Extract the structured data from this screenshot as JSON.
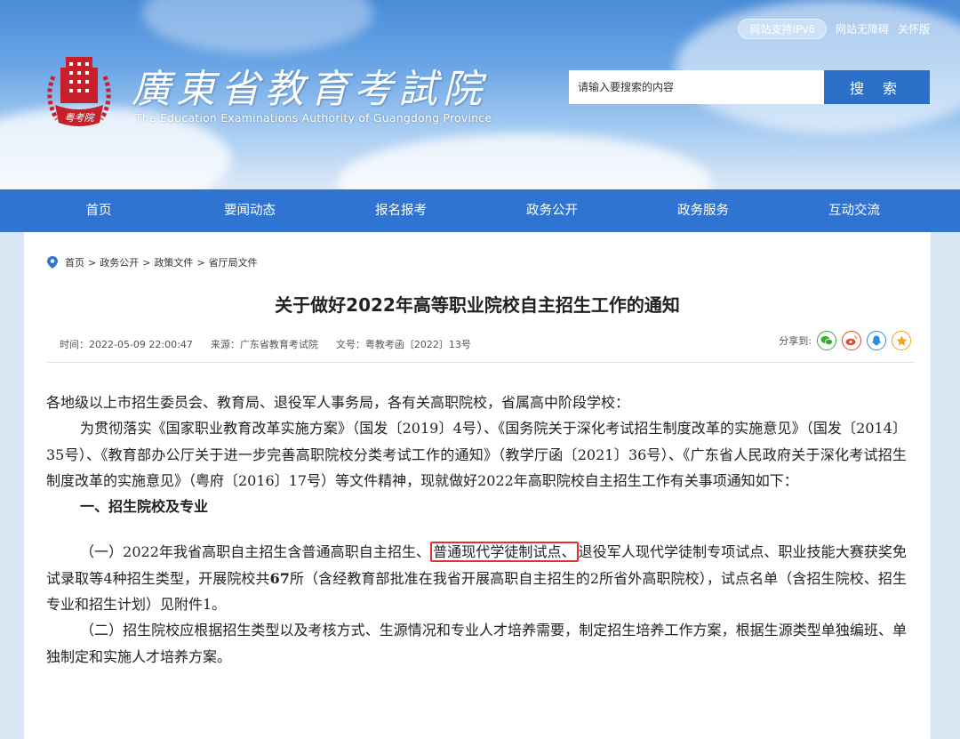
{
  "header": {
    "ipv6_badge": "网站支持IPv6",
    "accessibility_link": "网站无障碍",
    "care_link": "关怀版",
    "logo_text": "粤考院",
    "site_title": "廣東省教育考試院",
    "site_subtitle": "The Education Examinations Authority of Guangdong Province",
    "search": {
      "placeholder": "请输入要搜索的内容",
      "button_label": "搜 索"
    }
  },
  "nav": {
    "items": [
      {
        "label": "首页"
      },
      {
        "label": "要闻动态"
      },
      {
        "label": "报名报考"
      },
      {
        "label": "政务公开"
      },
      {
        "label": "政务服务"
      },
      {
        "label": "互动交流"
      }
    ]
  },
  "breadcrumb": [
    "首页",
    "政务公开",
    "政策文件",
    "省厅局文件"
  ],
  "article": {
    "title": "关于做好2022年高等职业院校自主招生工作的通知",
    "meta": {
      "time": "时间：2022-05-09 22:00:47",
      "source": "来源：广东省教育考试院",
      "doc_no": "文号：粤教考函〔2022〕13号"
    },
    "share_label": "分享到:",
    "share_targets": [
      "wechat-icon",
      "weibo-icon",
      "qq-icon",
      "qzone-icon"
    ],
    "colors": {
      "highlight_border": "#e0312f",
      "nav_bg": "#2f74d0",
      "search_button": "#2b6fc9"
    },
    "salutation": "各地级以上市招生委员会、教育局、退役军人事务局，各有关高职院校，省属高中阶段学校：",
    "intro": "为贯彻落实《国家职业教育改革实施方案》（国发〔2019〕4号）、《国务院关于深化考试招生制度改革的实施意见》（国发〔2014〕35号）、《教育部办公厅关于进一步完善高职院校分类考试工作的通知》（教学厅函〔2021〕36号）、《广东省人民政府关于深化考试招生制度改革的实施意见》（粤府〔2016〕17号）等文件精神，现就做好2022年高职院校自主招生工作有关事项通知如下：",
    "section1_heading": "一、招生院校及专业",
    "item1_before": "（一）2022年我省高职自主招生含普通高职自主招生、",
    "item1_highlight": "普通现代学徒制试点、",
    "item1_mid": "退役军人现代学徒制专项试点、职业技能大赛获奖免试录取等4种招生类型，开展院校共",
    "item1_count": "67",
    "item1_after": "所（含经教育部批准在我省开展高职自主招生的2所省外高职院校），试点名单（含招生院校、招生专业和招生计划）见附件1。",
    "item2": "（二）招生院校应根据招生类型以及考核方式、生源情况和专业人才培养需要，制定招生培养工作方案，根据生源类型单独编班、单独制定和实施人才培养方案。"
  }
}
